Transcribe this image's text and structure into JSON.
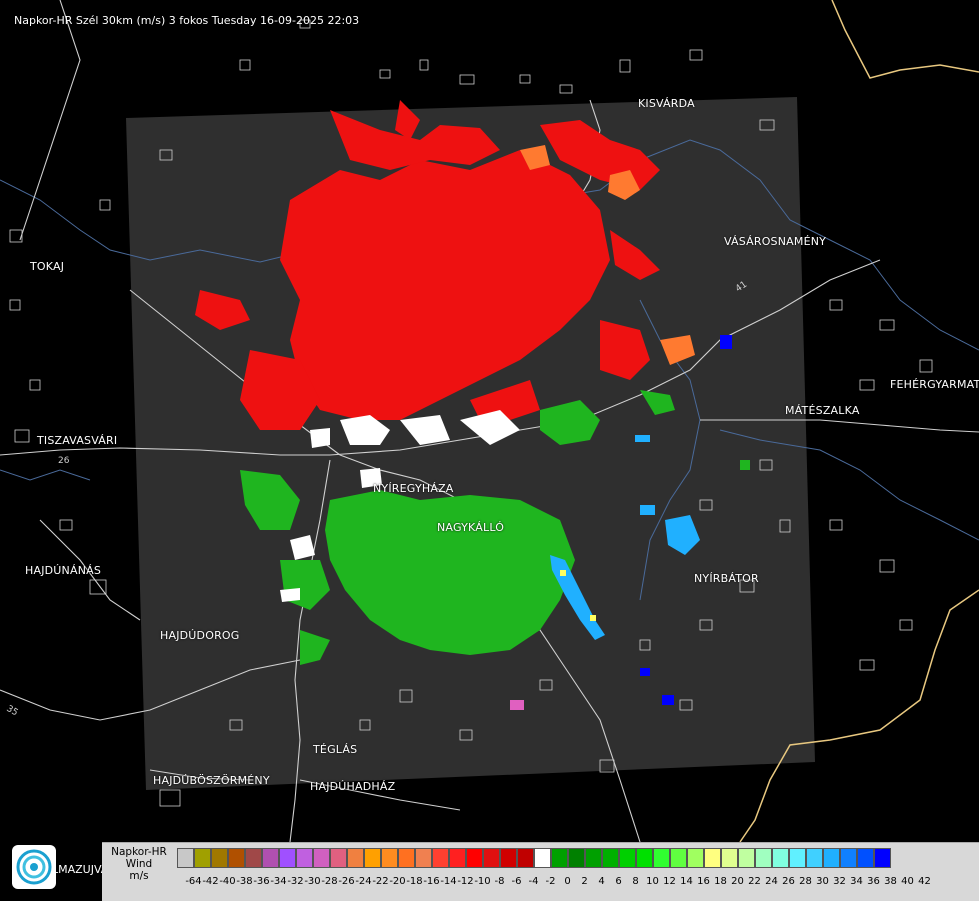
{
  "title": "Napkor-HR Szél 30km (m/s) 3 fokos Tuesday 16-09-2025 22:03",
  "cities": [
    {
      "name": "KISVÁRDA"
    },
    {
      "name": "VÁSÁROSNAMÉNY"
    },
    {
      "name": "TOKAJ"
    },
    {
      "name": "FEHÉRGYARMAT"
    },
    {
      "name": "MÁTÉSZALKA"
    },
    {
      "name": "TISZAVASVÁRI"
    },
    {
      "name": "NYÍREGYHÁZA"
    },
    {
      "name": "NAGYKÁLLÓ"
    },
    {
      "name": "HAJDÚNÁNÁS"
    },
    {
      "name": "NYÍRBÁTOR"
    },
    {
      "name": "HAJDÚDOROG"
    },
    {
      "name": "TÉGLÁS"
    },
    {
      "name": "HAJDÚBÖSZÖRMÉNY"
    },
    {
      "name": "HAJDÚHADHÁZ"
    }
  ],
  "road_labels": [
    "41",
    "26",
    "35"
  ],
  "legend": {
    "line1": "Napkor-HR",
    "line2": "Wind",
    "line3": "m/s",
    "logo_text": "LMAZUJVAR",
    "colors": [
      "#c8c8c8",
      "#a0a000",
      "#a07800",
      "#b05000",
      "#a04848",
      "#b050b0",
      "#a050ff",
      "#c060e0",
      "#d060c0",
      "#e06080",
      "#f08040",
      "#ffa000",
      "#ff8c20",
      "#ff7020",
      "#f08050",
      "#ff4030",
      "#ff2020",
      "#ff0000",
      "#e01010",
      "#d00000",
      "#c00000",
      "#ffffff",
      "#00a000",
      "#008000",
      "#00a000",
      "#00b000",
      "#00d000",
      "#00e000",
      "#30ff30",
      "#60ff40",
      "#a0ff60",
      "#ffff80",
      "#e0ff90",
      "#c0ffa0",
      "#a0ffc0",
      "#80ffe0",
      "#60f0ff",
      "#40d0ff",
      "#20b0ff",
      "#1080ff",
      "#0050ff",
      "#0000ff"
    ],
    "labels": [
      "",
      "-64",
      "-42",
      "-40",
      "-38",
      "-36",
      "-34",
      "-32",
      "-30",
      "-28",
      "-26",
      "-24",
      "-22",
      "-20",
      "-18",
      "-16",
      "-14",
      "-12",
      "-10",
      "-8",
      "-6",
      "-4",
      "-2",
      "0",
      "2",
      "4",
      "6",
      "8",
      "10",
      "12",
      "14",
      "16",
      "18",
      "20",
      "22",
      "24",
      "26",
      "28",
      "30",
      "32",
      "34",
      "36",
      "38",
      "40",
      "42"
    ]
  }
}
